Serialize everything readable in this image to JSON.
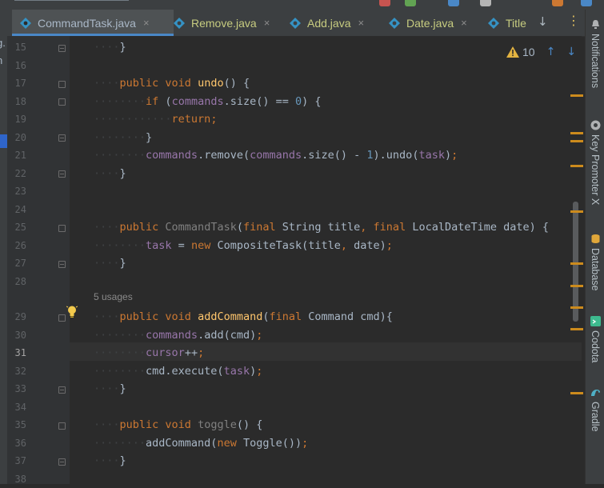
{
  "window": {
    "top_fragment": "—————————————",
    "colors": {
      "background": "#2b2b2b",
      "gutter": "#313335",
      "panel": "#3c3f41",
      "accent": "#4a88c7",
      "warning": "#e3b341"
    }
  },
  "project_panel": {
    "fragments": [
      "g.",
      "n"
    ]
  },
  "tabs": [
    {
      "label": "CommandTask.java",
      "active": true,
      "icon": "java-class-icon"
    },
    {
      "label": "Remove.java",
      "active": false,
      "icon": "java-class-icon"
    },
    {
      "label": "Add.java",
      "active": false,
      "icon": "java-class-icon"
    },
    {
      "label": "Date.java",
      "active": false,
      "icon": "java-class-icon"
    },
    {
      "label": "Title",
      "active": false,
      "icon": "java-class-icon"
    }
  ],
  "tab_controls": {
    "close_glyph": "×",
    "scroll_glyph": "↓",
    "menu_glyph": "⋮"
  },
  "inspection": {
    "warning_count": "10",
    "up_glyph": "↑",
    "down_glyph": "↓"
  },
  "editor": {
    "current_line": "31",
    "usages_hint": "5 usages",
    "line_numbers": [
      "15",
      "16",
      "17",
      "18",
      "19",
      "20",
      "21",
      "22",
      "23",
      "24",
      "25",
      "26",
      "27",
      "28",
      "29",
      "30",
      "31",
      "32",
      "33",
      "34",
      "35",
      "36",
      "37",
      "38"
    ]
  },
  "right_tools": [
    {
      "label": "Notifications",
      "icon": "bell-icon"
    },
    {
      "label": "Key Promoter X",
      "icon": "key-promoter-icon"
    },
    {
      "label": "Database",
      "icon": "database-icon"
    },
    {
      "label": "Codota",
      "icon": "codota-icon"
    },
    {
      "label": "Gradle",
      "icon": "gradle-icon"
    }
  ]
}
